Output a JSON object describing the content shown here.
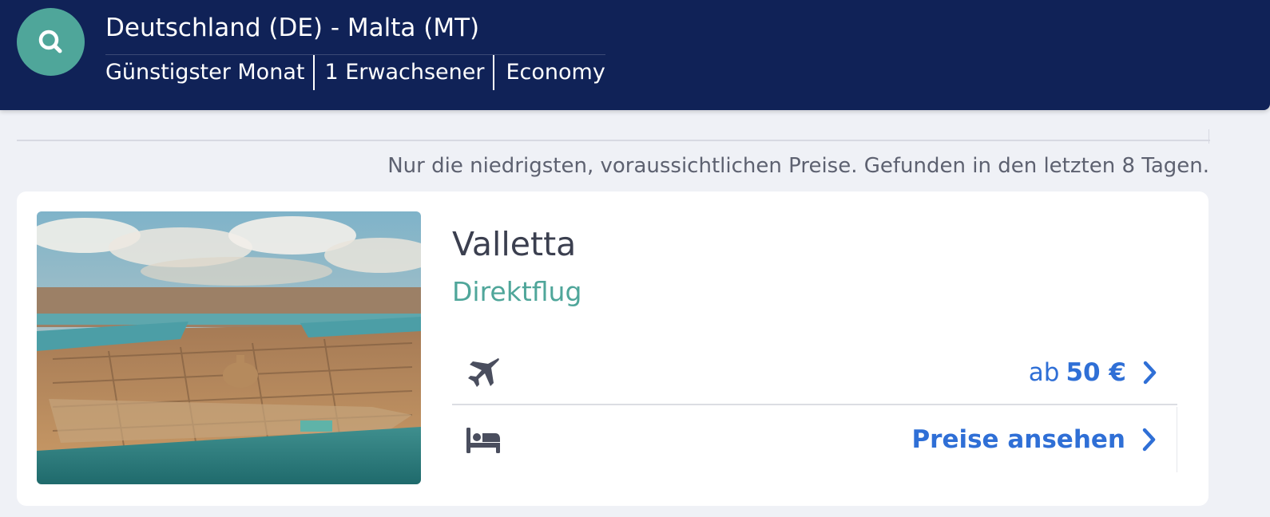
{
  "header": {
    "route_title": "Deutschland (DE) - Malta (MT)",
    "filters": {
      "month": "Günstigster Monat",
      "passengers": "1 Erwachsener",
      "cabin_class": "Economy"
    },
    "search_icon": "search-icon",
    "colors": {
      "background": "#102257",
      "search_button": "#4fa69a"
    }
  },
  "notice": "Nur die niedrigsten, voraussichtlichen Preise. Gefunden in den letzten 8 Tagen.",
  "result_card": {
    "city": "Valletta",
    "flight_type": "Direktflug",
    "flight_row": {
      "icon": "airplane-icon",
      "price_prefix": "ab",
      "price": "50 €"
    },
    "hotel_row": {
      "icon": "bed-icon",
      "link_label": "Preise ansehen"
    },
    "colors": {
      "accent": "#2f6fd6",
      "flight_type": "#4fa69a"
    }
  }
}
